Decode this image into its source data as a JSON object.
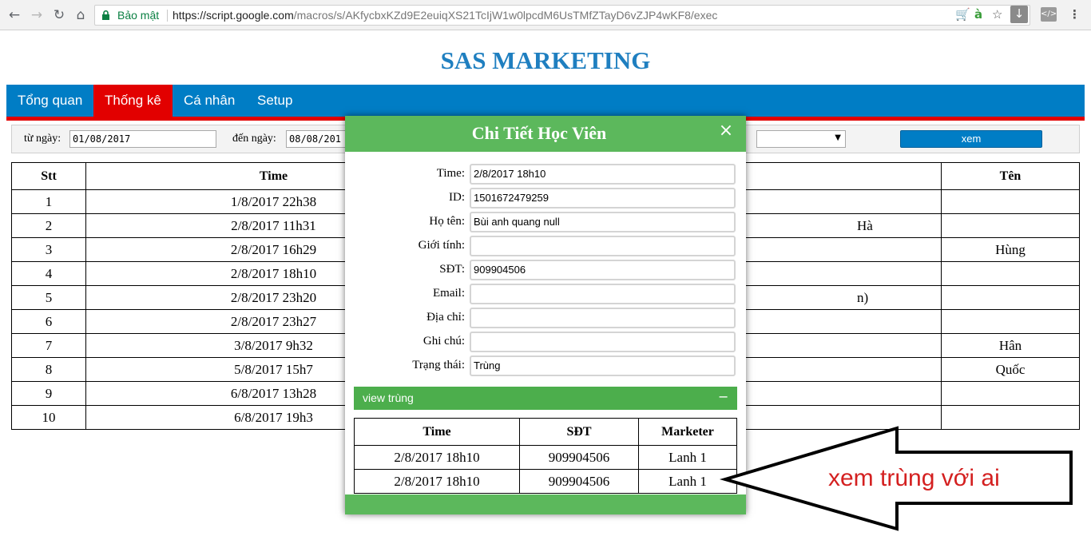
{
  "browser": {
    "secure_label": "Bảo mật",
    "url_host": "https://script.google.com",
    "url_path": "/macros/s/AKfycbxKZd9E2euiqXS21TcIjW1w0lpcdM6UsTMfZTayD6vZJP4wKF8/exec"
  },
  "header": {
    "title": "SAS MARKETING"
  },
  "nav": {
    "items": [
      {
        "label": "Tổng quan"
      },
      {
        "label": "Thống kê"
      },
      {
        "label": "Cá nhân"
      },
      {
        "label": "Setup"
      }
    ]
  },
  "filter": {
    "from_label": "từ ngày:",
    "from_value": "01/08/2017",
    "to_label": "đến ngày:",
    "to_value": "08/08/201",
    "button_label": "xem"
  },
  "table": {
    "headers": {
      "stt": "Stt",
      "time": "Time",
      "ten": "Tên"
    },
    "rows": [
      {
        "stt": "1",
        "time": "1/8/2017 22h38",
        "mid": "",
        "ten": ""
      },
      {
        "stt": "2",
        "time": "2/8/2017 11h31",
        "mid": "Hà",
        "ten": ""
      },
      {
        "stt": "3",
        "time": "2/8/2017 16h29",
        "mid": "",
        "ten": "Hùng"
      },
      {
        "stt": "4",
        "time": "2/8/2017 18h10",
        "mid": "",
        "ten": ""
      },
      {
        "stt": "5",
        "time": "2/8/2017 23h20",
        "mid": "n)",
        "ten": ""
      },
      {
        "stt": "6",
        "time": "2/8/2017 23h27",
        "mid": "",
        "ten": ""
      },
      {
        "stt": "7",
        "time": "3/8/2017 9h32",
        "mid": "",
        "ten": "Hân"
      },
      {
        "stt": "8",
        "time": "5/8/2017 15h7",
        "mid": "",
        "ten": "Quốc"
      },
      {
        "stt": "9",
        "time": "6/8/2017 13h28",
        "mid": "",
        "ten": ""
      },
      {
        "stt": "10",
        "time": "6/8/2017 19h3",
        "mid": "",
        "ten": ""
      }
    ]
  },
  "modal": {
    "title": "Chi Tiết Học Viên",
    "close": "×",
    "fields": [
      {
        "label": "Time:",
        "value": "2/8/2017 18h10"
      },
      {
        "label": "ID:",
        "value": "1501672479259"
      },
      {
        "label": "Họ tên:",
        "value": "Bùi anh quang null"
      },
      {
        "label": "Giới tính:",
        "value": ""
      },
      {
        "label": "SĐT:",
        "value": "909904506"
      },
      {
        "label": "Email:",
        "value": ""
      },
      {
        "label": "Địa chỉ:",
        "value": ""
      },
      {
        "label": "Ghi chú:",
        "value": ""
      },
      {
        "label": "Trạng thái:",
        "value": "Trùng"
      }
    ],
    "collapse": {
      "label": "view trùng",
      "icon": "−"
    },
    "dup_table": {
      "headers": {
        "time": "Time",
        "sdt": "SĐT",
        "marketer": "Marketer"
      },
      "rows": [
        {
          "time": "2/8/2017 18h10",
          "sdt": "909904506",
          "marketer": "Lanh 1"
        },
        {
          "time": "2/8/2017 18h10",
          "sdt": "909904506",
          "marketer": "Lanh 1"
        }
      ]
    }
  },
  "annotation": {
    "text": "xem trùng với ai",
    "color": "#d42020"
  },
  "colors": {
    "brand_blue": "#007dc5",
    "accent_red": "#e20000",
    "modal_green": "#5cb85c",
    "title_blue": "#1f7fc0"
  }
}
